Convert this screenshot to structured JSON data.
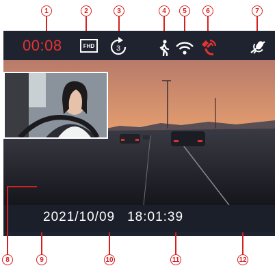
{
  "callouts": [
    "1",
    "2",
    "3",
    "4",
    "5",
    "6",
    "7",
    "8",
    "9",
    "10",
    "11",
    "12"
  ],
  "status_bar": {
    "recording_time": "00:08",
    "resolution_badge": "FHD",
    "loop_minutes": "3",
    "icons": [
      "loop-recording-icon",
      "parking-monitor-icon",
      "wifi-icon",
      "gps-icon",
      "mic-muted-icon"
    ]
  },
  "overlay": {
    "date": "2021/10/09",
    "time": "18:01:39"
  },
  "bottom_bar": {
    "buttons": [
      "lock-icon",
      "camera-icon",
      "pip-switch-icon",
      "stop-icon"
    ]
  },
  "colors": {
    "accent_red": "#e8322f",
    "accent_blue": "#2f9fe0",
    "bar_bg": "#1f2330",
    "callout_red": "#d81f1f"
  }
}
